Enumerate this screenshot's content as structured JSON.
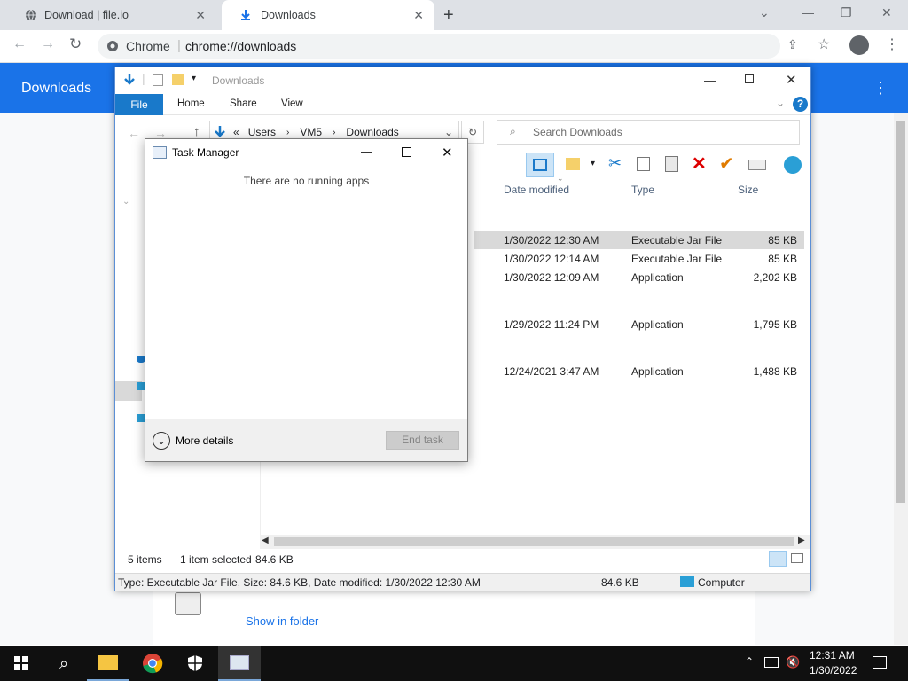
{
  "browser": {
    "tabs": [
      {
        "label": "Download | file.io",
        "icon": "globe-icon"
      },
      {
        "label": "Downloads",
        "icon": "download-icon"
      }
    ],
    "omnibox": {
      "scheme": "Chrome",
      "url": "chrome://downloads"
    },
    "page_title": "Downloads",
    "show_in_folder": "Show in folder"
  },
  "explorer": {
    "title": "Downloads",
    "ribbon_tabs": [
      "File",
      "Home",
      "Share",
      "View"
    ],
    "breadcrumb": [
      "Users",
      "VM5",
      "Downloads"
    ],
    "search_placeholder": "Search Downloads",
    "columns": [
      "Date modified",
      "Type",
      "Size"
    ],
    "rows": [
      {
        "date": "1/30/2022 12:30 AM",
        "type": "Executable Jar File",
        "size": "85 KB",
        "selected": true
      },
      {
        "date": "1/30/2022 12:14 AM",
        "type": "Executable Jar File",
        "size": "85 KB",
        "selected": false
      },
      {
        "date": "1/30/2022 12:09 AM",
        "type": "Application",
        "size": "2,202 KB",
        "selected": false
      },
      {
        "date": "1/29/2022 11:24 PM",
        "type": "Application",
        "size": "1,795 KB",
        "selected": false
      },
      {
        "date": "12/24/2021 3:47 AM",
        "type": "Application",
        "size": "1,488 KB",
        "selected": false
      }
    ],
    "status": {
      "items": "5 items",
      "selected": "1 item selected",
      "selected_size": "84.6 KB"
    },
    "details": {
      "text": "Type: Executable Jar File, Size: 84.6 KB, Date modified: 1/30/2022 12:30 AM",
      "size": "84.6 KB",
      "location": "Computer"
    }
  },
  "task_manager": {
    "title": "Task Manager",
    "empty_message": "There are no running apps",
    "more_details": "More details",
    "end_task": "End task"
  },
  "taskbar": {
    "time": "12:31 AM",
    "date": "1/30/2022"
  },
  "colors": {
    "chrome_blue": "#1a73e8",
    "ribbon_blue": "#1979ca",
    "selected_row": "#d9d9d9"
  }
}
